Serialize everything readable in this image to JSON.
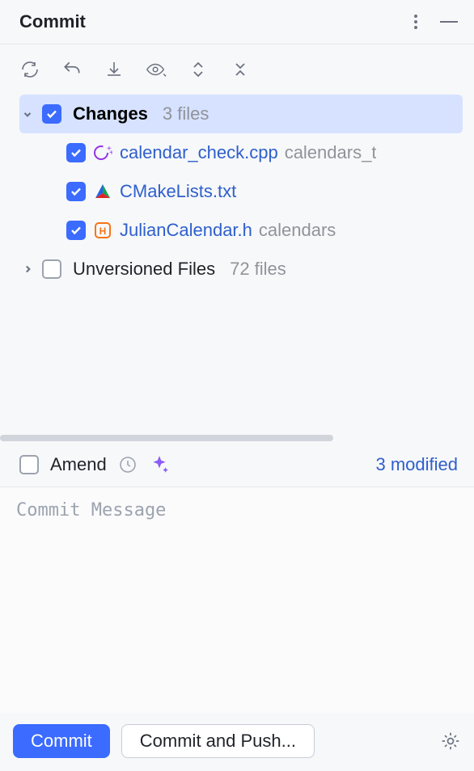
{
  "header": {
    "title": "Commit"
  },
  "changes": {
    "label": "Changes",
    "count": "3 files",
    "files": [
      {
        "name": "calendar_check.cpp",
        "path": "calendars_t",
        "icon": "cpp"
      },
      {
        "name": "CMakeLists.txt",
        "path": "",
        "icon": "cmake"
      },
      {
        "name": "JulianCalendar.h",
        "path": "calendars",
        "icon": "header"
      }
    ]
  },
  "unversioned": {
    "label": "Unversioned Files",
    "count": "72 files"
  },
  "amend": {
    "label": "Amend"
  },
  "modified_text": "3 modified",
  "commit_message_placeholder": "Commit Message",
  "buttons": {
    "commit": "Commit",
    "commit_push": "Commit and Push..."
  }
}
